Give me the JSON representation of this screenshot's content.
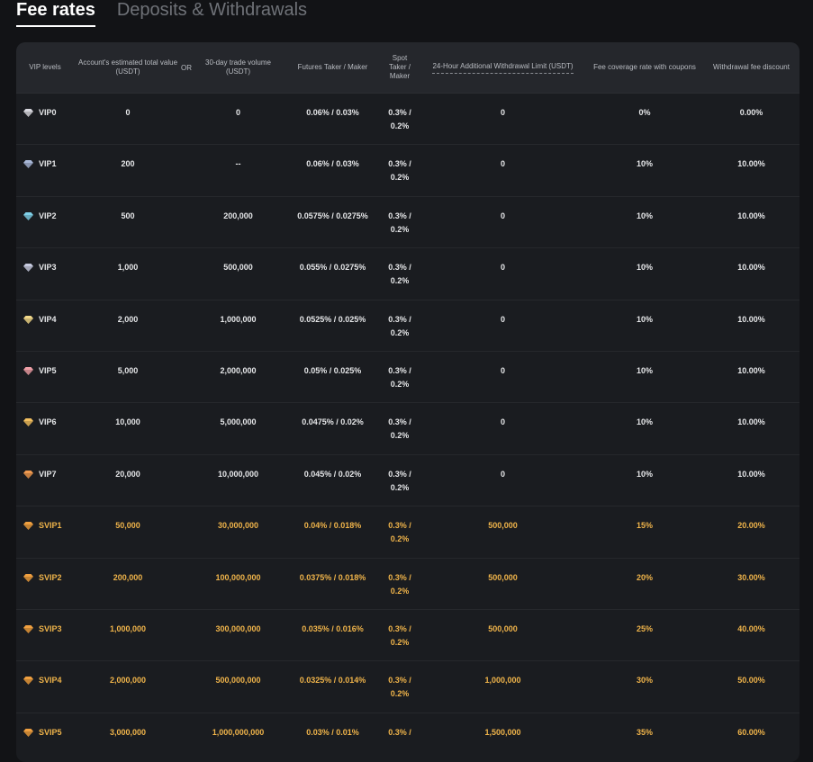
{
  "tabs": [
    {
      "label": "Fee rates",
      "active": true
    },
    {
      "label": "Deposits & Withdrawals",
      "active": false
    }
  ],
  "headers": {
    "vip": "VIP levels",
    "estimated_value": "Account's estimated total value (USDT)",
    "or": "OR",
    "trade_volume": "30-day trade volume (USDT)",
    "futures": "Futures Taker / Maker",
    "spot": "Spot Taker / Maker",
    "withdrawal_limit": "24-Hour Additional Withdrawal Limit (USDT)",
    "fee_coverage": "Fee coverage rate with coupons",
    "withdrawal_discount": "Withdrawal fee discount"
  },
  "colors": {
    "accent_gold": "#f0b44a",
    "text": "#e6e7e9",
    "background": "#121316"
  },
  "rows": [
    {
      "level": "VIP0",
      "gem_color": "#d9d9e0",
      "value": "0",
      "volume": "0",
      "futures": "0.06% / 0.03%",
      "spot": "0.3% / 0.2%",
      "limit": "0",
      "coverage": "0%",
      "discount": "0.00%",
      "gold": false
    },
    {
      "level": "VIP1",
      "gem_color": "#a9b8d8",
      "value": "200",
      "volume": "--",
      "futures": "0.06% / 0.03%",
      "spot": "0.3% / 0.2%",
      "limit": "0",
      "coverage": "10%",
      "discount": "10.00%",
      "gold": false
    },
    {
      "level": "VIP2",
      "gem_color": "#7fd0e8",
      "value": "500",
      "volume": "200,000",
      "futures": "0.0575% / 0.0275%",
      "spot": "0.3% / 0.2%",
      "limit": "0",
      "coverage": "10%",
      "discount": "10.00%",
      "gold": false
    },
    {
      "level": "VIP3",
      "gem_color": "#c7cbe0",
      "value": "1,000",
      "volume": "500,000",
      "futures": "0.055% / 0.0275%",
      "spot": "0.3% / 0.2%",
      "limit": "0",
      "coverage": "10%",
      "discount": "10.00%",
      "gold": false
    },
    {
      "level": "VIP4",
      "gem_color": "#f3d98a",
      "value": "2,000",
      "volume": "1,000,000",
      "futures": "0.0525% / 0.025%",
      "spot": "0.3% / 0.2%",
      "limit": "0",
      "coverage": "10%",
      "discount": "10.00%",
      "gold": false
    },
    {
      "level": "VIP5",
      "gem_color": "#f0a0a8",
      "value": "5,000",
      "volume": "2,000,000",
      "futures": "0.05% / 0.025%",
      "spot": "0.3% / 0.2%",
      "limit": "0",
      "coverage": "10%",
      "discount": "10.00%",
      "gold": false
    },
    {
      "level": "VIP6",
      "gem_color": "#f3c060",
      "value": "10,000",
      "volume": "5,000,000",
      "futures": "0.0475% / 0.02%",
      "spot": "0.3% / 0.2%",
      "limit": "0",
      "coverage": "10%",
      "discount": "10.00%",
      "gold": false
    },
    {
      "level": "VIP7",
      "gem_color": "#f09a50",
      "value": "20,000",
      "volume": "10,000,000",
      "futures": "0.045% / 0.02%",
      "spot": "0.3% / 0.2%",
      "limit": "0",
      "coverage": "10%",
      "discount": "10.00%",
      "gold": false
    },
    {
      "level": "SVIP1",
      "gem_color": "#f0a040",
      "value": "50,000",
      "volume": "30,000,000",
      "futures": "0.04% / 0.018%",
      "spot": "0.3% / 0.2%",
      "limit": "500,000",
      "coverage": "15%",
      "discount": "20.00%",
      "gold": true
    },
    {
      "level": "SVIP2",
      "gem_color": "#f0a040",
      "value": "200,000",
      "volume": "100,000,000",
      "futures": "0.0375% / 0.018%",
      "spot": "0.3% / 0.2%",
      "limit": "500,000",
      "coverage": "20%",
      "discount": "30.00%",
      "gold": true
    },
    {
      "level": "SVIP3",
      "gem_color": "#f0a040",
      "value": "1,000,000",
      "volume": "300,000,000",
      "futures": "0.035% / 0.016%",
      "spot": "0.3% / 0.2%",
      "limit": "500,000",
      "coverage": "25%",
      "discount": "40.00%",
      "gold": true
    },
    {
      "level": "SVIP4",
      "gem_color": "#f0a040",
      "value": "2,000,000",
      "volume": "500,000,000",
      "futures": "0.0325% / 0.014%",
      "spot": "0.3% / 0.2%",
      "limit": "1,000,000",
      "coverage": "30%",
      "discount": "50.00%",
      "gold": true
    },
    {
      "level": "SVIP5",
      "gem_color": "#f0a040",
      "value": "3,000,000",
      "volume": "1,000,000,000",
      "futures": "0.03% / 0.01%",
      "spot": "0.3% /",
      "limit": "1,500,000",
      "coverage": "35%",
      "discount": "60.00%",
      "gold": true
    }
  ]
}
